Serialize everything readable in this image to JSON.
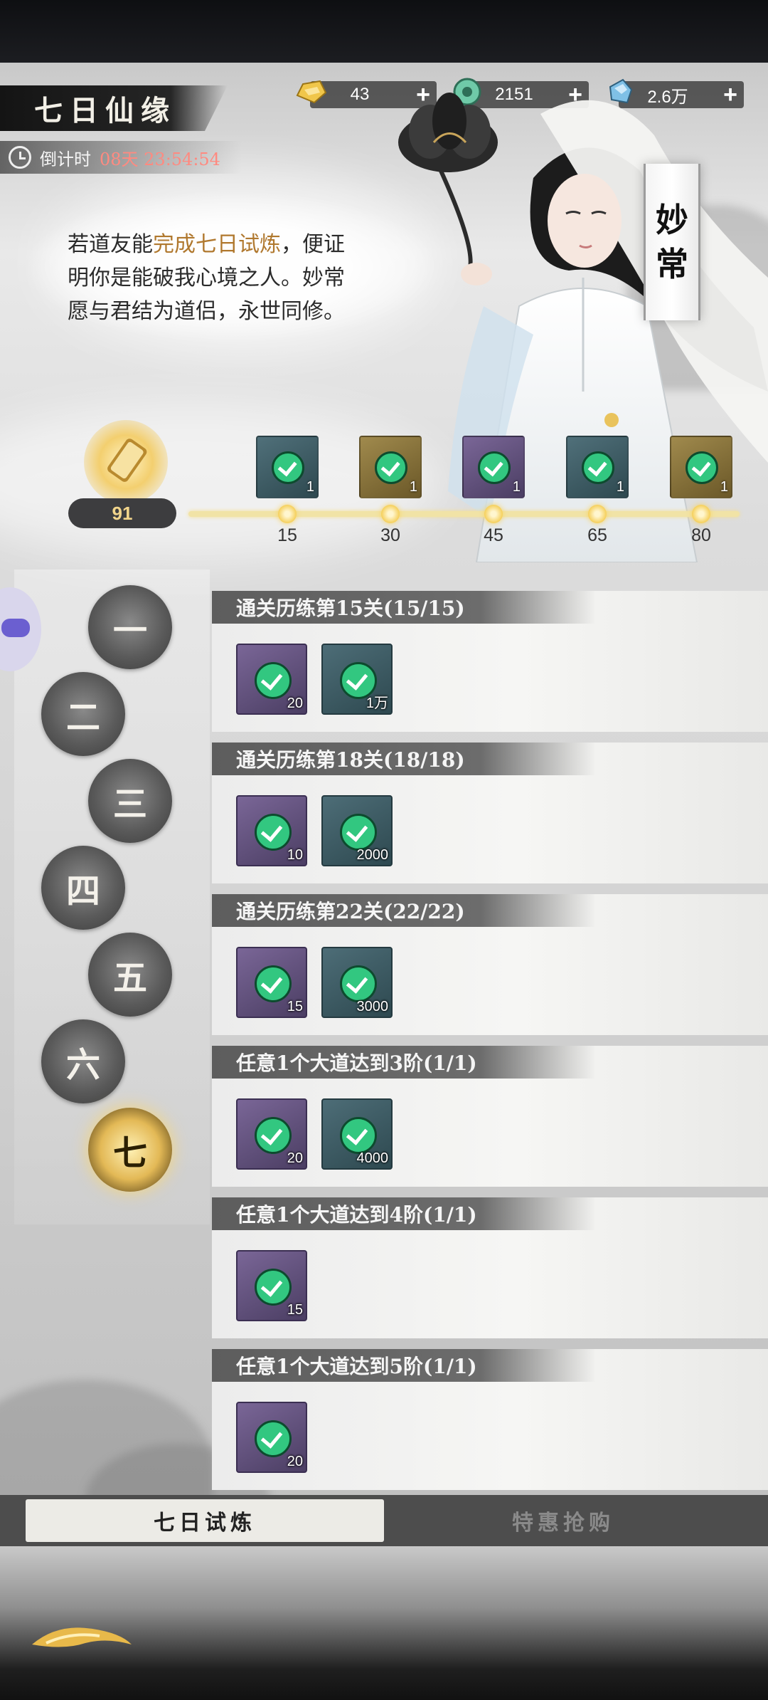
{
  "header": {
    "title": "七日仙缘",
    "countdown_label": "倒计时",
    "countdown_value": "08天 23:54:54"
  },
  "currencies": [
    {
      "icon": "gold-ingot-icon",
      "value": "43"
    },
    {
      "icon": "jade-coin-icon",
      "value": "2151"
    },
    {
      "icon": "spirit-stone-icon",
      "value": "2.6万"
    }
  ],
  "dialog": {
    "line1_pre": "若道友能",
    "line1_highlight": "完成七日试炼",
    "line1_post": "，便证",
    "line2": "明你是能破我心境之人。妙常",
    "line3": "愿与君结为道侣，永世同修。"
  },
  "character": {
    "name_1": "妙",
    "name_2": "常"
  },
  "progress": {
    "points": "91",
    "milestones": [
      {
        "value": "15",
        "reward_count": "1",
        "color": "teal"
      },
      {
        "value": "30",
        "reward_count": "1",
        "color": "gold"
      },
      {
        "value": "45",
        "reward_count": "1",
        "color": "purple"
      },
      {
        "value": "65",
        "reward_count": "1",
        "color": "teal"
      },
      {
        "value": "80",
        "reward_count": "1",
        "color": "gold"
      }
    ]
  },
  "days": [
    "一",
    "二",
    "三",
    "四",
    "五",
    "六",
    "七"
  ],
  "active_day": "七",
  "tasks": [
    {
      "title": "通关历练第15关(15/15)",
      "rewards": [
        {
          "type": "purple",
          "qty": "20"
        },
        {
          "type": "teal",
          "qty": "1万"
        }
      ]
    },
    {
      "title": "通关历练第18关(18/18)",
      "rewards": [
        {
          "type": "purple",
          "qty": "10"
        },
        {
          "type": "teal",
          "qty": "2000"
        }
      ]
    },
    {
      "title": "通关历练第22关(22/22)",
      "rewards": [
        {
          "type": "purple",
          "qty": "15"
        },
        {
          "type": "teal",
          "qty": "3000"
        }
      ]
    },
    {
      "title": "任意1个大道达到3阶(1/1)",
      "rewards": [
        {
          "type": "purple",
          "qty": "20"
        },
        {
          "type": "teal",
          "qty": "4000"
        }
      ]
    },
    {
      "title": "任意1个大道达到4阶(1/1)",
      "rewards": [
        {
          "type": "purple",
          "qty": "15"
        }
      ]
    },
    {
      "title": "任意1个大道达到5阶(1/1)",
      "rewards": [
        {
          "type": "purple",
          "qty": "20"
        }
      ]
    }
  ],
  "tabs": {
    "trial": "七日试炼",
    "shop": "特惠抢购"
  },
  "colors": {
    "highlight": "#b0782e",
    "countdown": "#ff8a80",
    "check": "#32c780",
    "gold": "#f5cf5a"
  }
}
